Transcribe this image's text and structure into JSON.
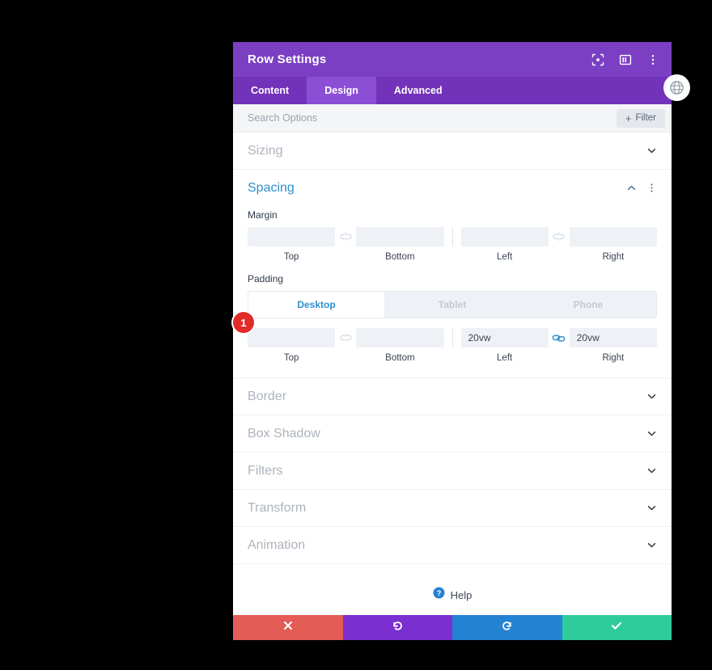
{
  "window": {
    "title": "Row Settings",
    "header_icons": [
      {
        "name": "focus-target-icon"
      },
      {
        "name": "layout-panel-icon"
      },
      {
        "name": "more-vertical-icon"
      }
    ]
  },
  "tabs": [
    {
      "label": "Content",
      "active": false
    },
    {
      "label": "Design",
      "active": true
    },
    {
      "label": "Advanced",
      "active": false
    }
  ],
  "search": {
    "placeholder": "Search Options",
    "value": "",
    "filter_label": "Filter",
    "filter_plus": "+"
  },
  "sections": [
    {
      "label": "Sizing",
      "state": "collapsed"
    },
    {
      "label": "Spacing",
      "state": "open"
    },
    {
      "label": "Border",
      "state": "collapsed"
    },
    {
      "label": "Box Shadow",
      "state": "collapsed"
    },
    {
      "label": "Filters",
      "state": "collapsed"
    },
    {
      "label": "Transform",
      "state": "collapsed"
    },
    {
      "label": "Animation",
      "state": "collapsed"
    }
  ],
  "spacing": {
    "margin": {
      "label": "Margin",
      "top": {
        "label": "Top",
        "value": ""
      },
      "bottom": {
        "label": "Bottom",
        "value": ""
      },
      "left": {
        "label": "Left",
        "value": ""
      },
      "right": {
        "label": "Right",
        "value": ""
      },
      "link_top_bottom": {
        "name": "link-broken-icon",
        "active": false
      },
      "link_left_right": {
        "name": "link-broken-icon",
        "active": false
      }
    },
    "padding": {
      "label": "Padding",
      "devices": [
        {
          "label": "Desktop",
          "active": true
        },
        {
          "label": "Tablet",
          "active": false
        },
        {
          "label": "Phone",
          "active": false
        }
      ],
      "top": {
        "label": "Top",
        "value": ""
      },
      "bottom": {
        "label": "Bottom",
        "value": ""
      },
      "left": {
        "label": "Left",
        "value": "20vw"
      },
      "right": {
        "label": "Right",
        "value": "20vw"
      },
      "link_top_bottom": {
        "name": "link-broken-icon",
        "active": false
      },
      "link_left_right": {
        "name": "link-connected-icon",
        "active": true
      },
      "badge": "1"
    }
  },
  "help": {
    "label": "Help",
    "icon": "question-circle-icon"
  },
  "footer": [
    {
      "name": "cancel-button",
      "icon": "close-x-icon",
      "color": "#e35c55"
    },
    {
      "name": "undo-button",
      "icon": "undo-arrow-icon",
      "color": "#7b2fd0"
    },
    {
      "name": "redo-button",
      "icon": "redo-arrow-icon",
      "color": "#2482d3"
    },
    {
      "name": "save-button",
      "icon": "checkmark-icon",
      "color": "#2ecc9b"
    }
  ],
  "side_button": {
    "name": "globe-preview-icon"
  },
  "colors": {
    "titlebar": "#7b3fc4",
    "tabbar": "#7332ba",
    "tab_active": "#8b4fd6",
    "accent_blue": "#2f8fd0",
    "badge_red": "#e02b27"
  }
}
